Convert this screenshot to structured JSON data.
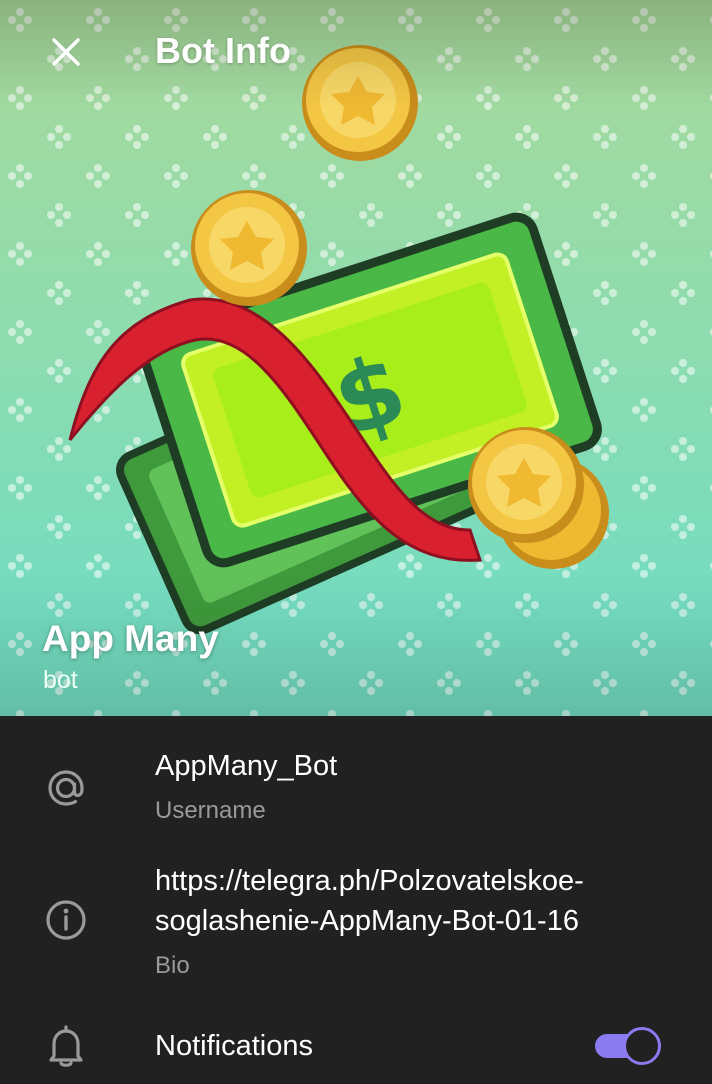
{
  "header": {
    "title": "Bot Info",
    "close_icon": "close-icon"
  },
  "profile": {
    "name": "App Many",
    "subtitle": "bot",
    "photo_icon": "money-stack-with-coins"
  },
  "info": {
    "username": {
      "value": "AppMany_Bot",
      "label": "Username",
      "icon": "at-icon"
    },
    "bio": {
      "line1": "https://telegra.ph/Polzovatelskoe-",
      "line2": "soglashenie-AppMany-Bot-01-16",
      "label": "Bio",
      "icon": "info-icon"
    },
    "notifications": {
      "label": "Notifications",
      "icon": "bell-icon",
      "enabled": true
    }
  },
  "colors": {
    "background": "#212121",
    "accent": "#8a7cf0",
    "secondary_text": "#9a9a9a"
  }
}
